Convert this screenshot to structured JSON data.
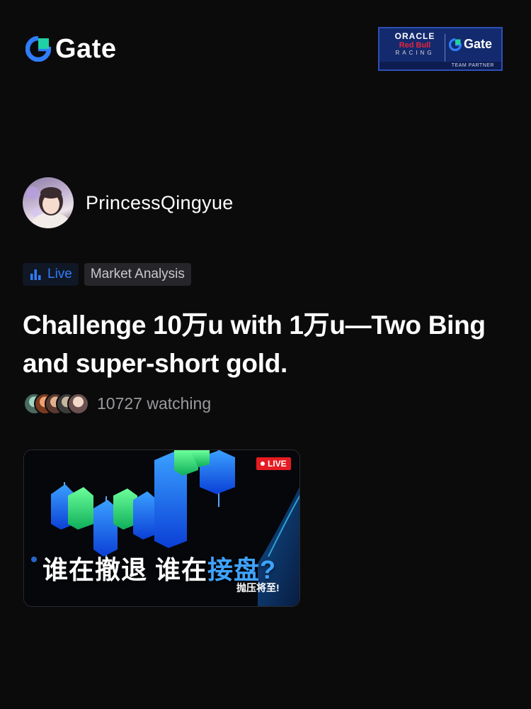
{
  "brand": {
    "name": "Gate",
    "icon": "gate-logo-icon",
    "color": "#2f7dfa"
  },
  "partner": {
    "oracle": "ORACLE",
    "redbull": "Red Bull",
    "racing": "RACING",
    "gate": "Gate",
    "caption": "TEAM PARTNER"
  },
  "author": {
    "name": "PrincessQingyue",
    "avatar_icon": "user-avatar"
  },
  "tags": {
    "live_label": "Live",
    "live_icon": "bar-chart-icon",
    "live_color": "#2f7dfa",
    "topic_label": "Market Analysis"
  },
  "post": {
    "title": "Challenge 10万u with 1万u—Two Bing and super-short gold."
  },
  "watchers": {
    "count_text": "10727 watching"
  },
  "thumbnail": {
    "badge": "LIVE",
    "headline_part1": "谁在撤退 谁在",
    "headline_part2": "接盘?",
    "sub": "抛压将至!"
  }
}
